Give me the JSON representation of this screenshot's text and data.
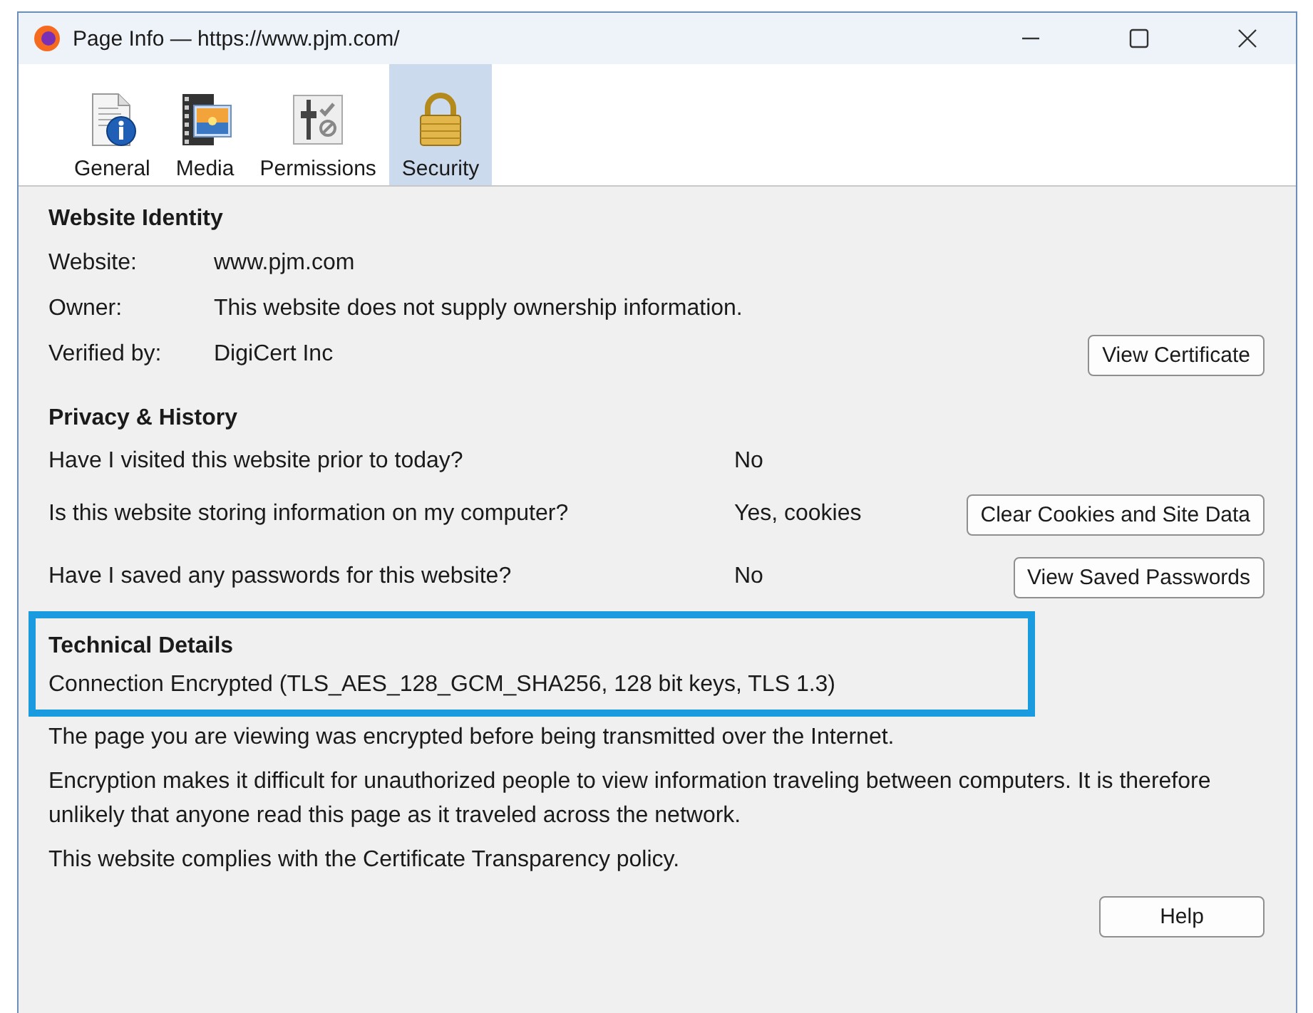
{
  "window": {
    "title": "Page Info — https://www.pjm.com/"
  },
  "tabs": [
    {
      "label": "General",
      "kind": "general",
      "selected": false
    },
    {
      "label": "Media",
      "kind": "media",
      "selected": false
    },
    {
      "label": "Permissions",
      "kind": "permissions",
      "selected": false
    },
    {
      "label": "Security",
      "kind": "security",
      "selected": true
    }
  ],
  "website_identity": {
    "heading": "Website Identity",
    "rows": [
      {
        "label": "Website:",
        "value": "www.pjm.com"
      },
      {
        "label": "Owner:",
        "value": "This website does not supply ownership information."
      },
      {
        "label": "Verified by:",
        "value": "DigiCert Inc",
        "button": "View Certificate"
      }
    ]
  },
  "privacy_history": {
    "heading": "Privacy & History",
    "rows": [
      {
        "question": "Have I visited this website prior to today?",
        "answer": "No"
      },
      {
        "question": "Is this website storing information on my computer?",
        "answer": "Yes, cookies",
        "button": "Clear Cookies and Site Data"
      },
      {
        "question": "Have I saved any passwords for this website?",
        "answer": "No",
        "button": "View Saved Passwords"
      }
    ]
  },
  "technical_details": {
    "heading": "Technical Details",
    "highlighted": true,
    "connection": "Connection Encrypted (TLS_AES_128_GCM_SHA256, 128 bit keys, TLS 1.3)",
    "paragraphs": [
      "The page you are viewing was encrypted before being transmitted over the Internet.",
      "Encryption makes it difficult for unauthorized people to view information traveling between computers. It is therefore unlikely that anyone read this page as it traveled across the network.",
      "This website complies with the Certificate Transparency policy."
    ]
  },
  "help_button": "Help"
}
